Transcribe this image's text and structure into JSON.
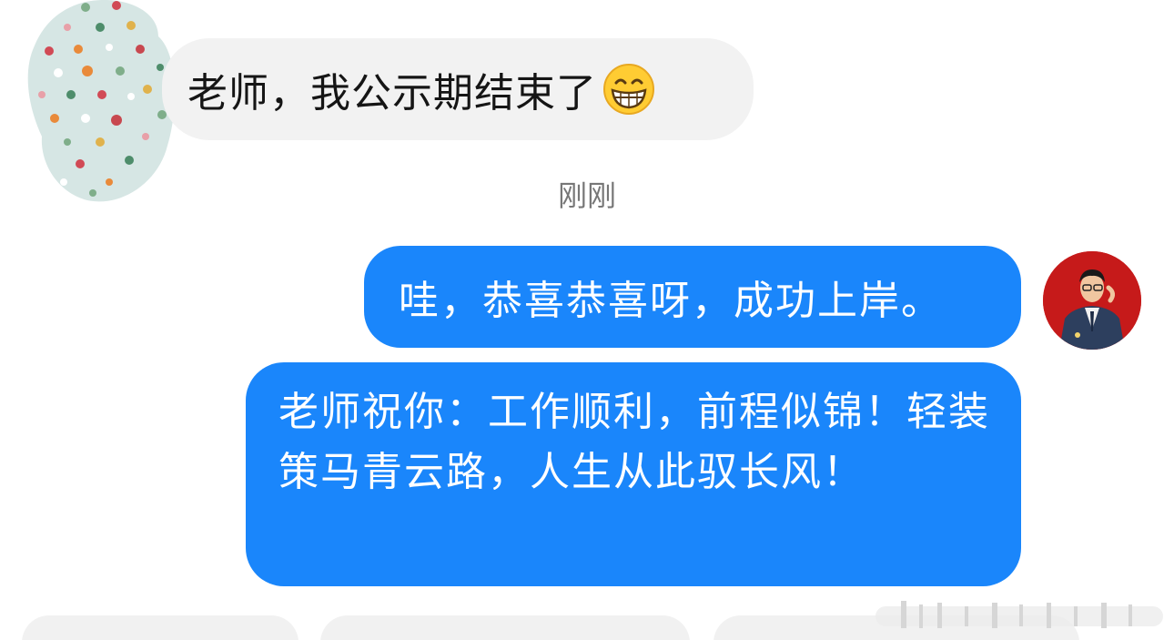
{
  "messages": {
    "incoming": {
      "text": "老师，我公示期结束了",
      "emoji": "grinning-face-emoji"
    },
    "timestamp": "刚刚",
    "outgoing": [
      {
        "text": "哇，恭喜恭喜呀，成功上岸。"
      },
      {
        "text": "老师祝你：工作顺利，前程似锦！轻装策马青云路，人生从此驭长风！"
      }
    ]
  },
  "colors": {
    "outgoing_bubble": "#1a86fb",
    "incoming_bubble": "#f2f2f2",
    "right_avatar_bg": "#c61a1a"
  }
}
